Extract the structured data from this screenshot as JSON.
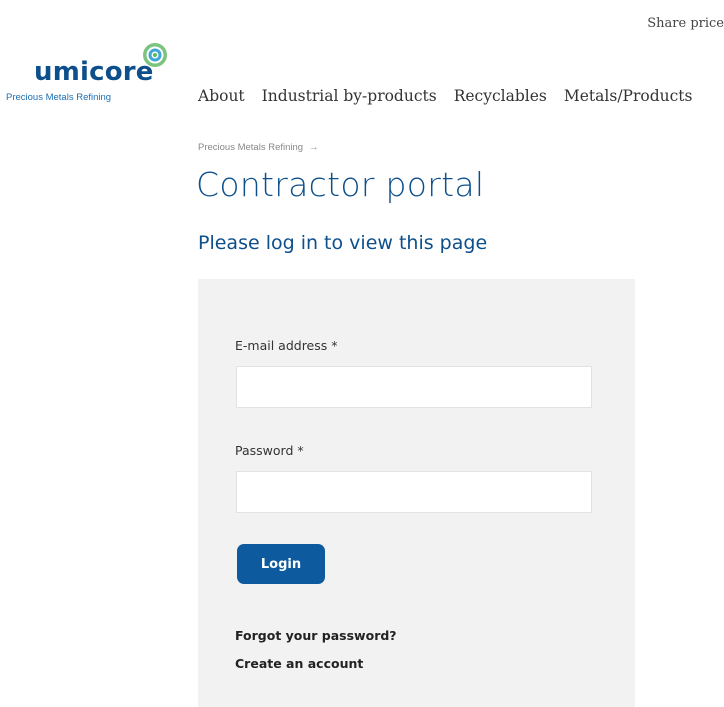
{
  "header": {
    "share_price": "Share price",
    "logo": {
      "wordmark": "umicore",
      "tagline": "Precious Metals Refining"
    }
  },
  "nav": {
    "items": [
      {
        "label": "About"
      },
      {
        "label": "Industrial by-products"
      },
      {
        "label": "Recyclables"
      },
      {
        "label": "Metals/Products"
      }
    ]
  },
  "breadcrumb": {
    "label": "Precious Metals Refining",
    "arrow": "→"
  },
  "main": {
    "title": "Contractor portal",
    "subtitle": "Please log in to view this page"
  },
  "form": {
    "email_label": "E-mail address *",
    "email_value": "",
    "password_label": "Password *",
    "password_value": "",
    "login_label": "Login",
    "forgot_link": "Forgot your password?",
    "create_link": "Create an account"
  },
  "colors": {
    "brand": "#0d4f8b",
    "button": "#0d5b9e",
    "panel_bg": "#f2f2f2",
    "logo_mark": "#5cb85c"
  },
  "icons": {
    "logo_mark": "umicore-swirl-icon",
    "breadcrumb_arrow": "arrow-right-icon"
  }
}
